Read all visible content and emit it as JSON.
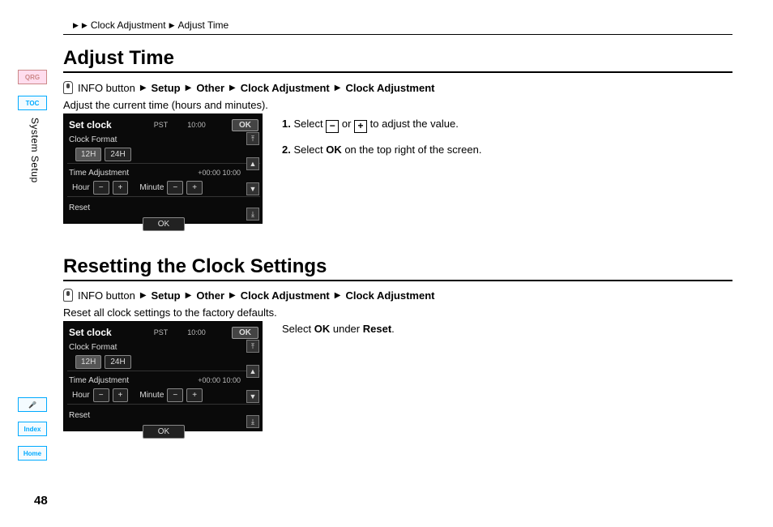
{
  "pageNumber": "48",
  "sideTabs": {
    "qrg": "QRG",
    "toc": "TOC",
    "voice": "🎤",
    "index": "Index",
    "home": "Home"
  },
  "verticalLabel": "System Setup",
  "breadcrumb": {
    "a": "Clock Adjustment",
    "b": "Adjust Time"
  },
  "headings": {
    "adjust": "Adjust Time",
    "reset": "Resetting the Clock Settings"
  },
  "navPath": {
    "info": "INFO button",
    "setup": "Setup",
    "other": "Other",
    "ca1": "Clock Adjustment",
    "ca2": "Clock Adjustment"
  },
  "body": {
    "adjust": "Adjust the current time (hours and minutes).",
    "reset": "Reset all clock settings to the factory defaults."
  },
  "steps": {
    "s1a": "1.",
    "s1b": "Select",
    "s1c": "or",
    "s1d": "to adjust the value.",
    "s2a": "2.",
    "s2b": "Select ",
    "s2c": "OK",
    "s2d": " on the top right of the screen."
  },
  "rightNote": {
    "a": "Select ",
    "b": "OK",
    "c": " under ",
    "d": "Reset",
    "e": "."
  },
  "shot": {
    "title": "Set clock",
    "tz": "PST",
    "time": "10:00",
    "ok": "OK",
    "cf": "Clock Format",
    "h12": "12H",
    "h24": "24H",
    "ta": "Time Adjustment",
    "offset": "+00:00  10:00",
    "hour": "Hour",
    "minute": "Minute",
    "minus": "−",
    "plus": "+",
    "resetLbl": "Reset",
    "okBtn": "OK",
    "arr": {
      "dtop": "⤒",
      "up": "▲",
      "down": "▼",
      "dbot": "⤓"
    }
  }
}
